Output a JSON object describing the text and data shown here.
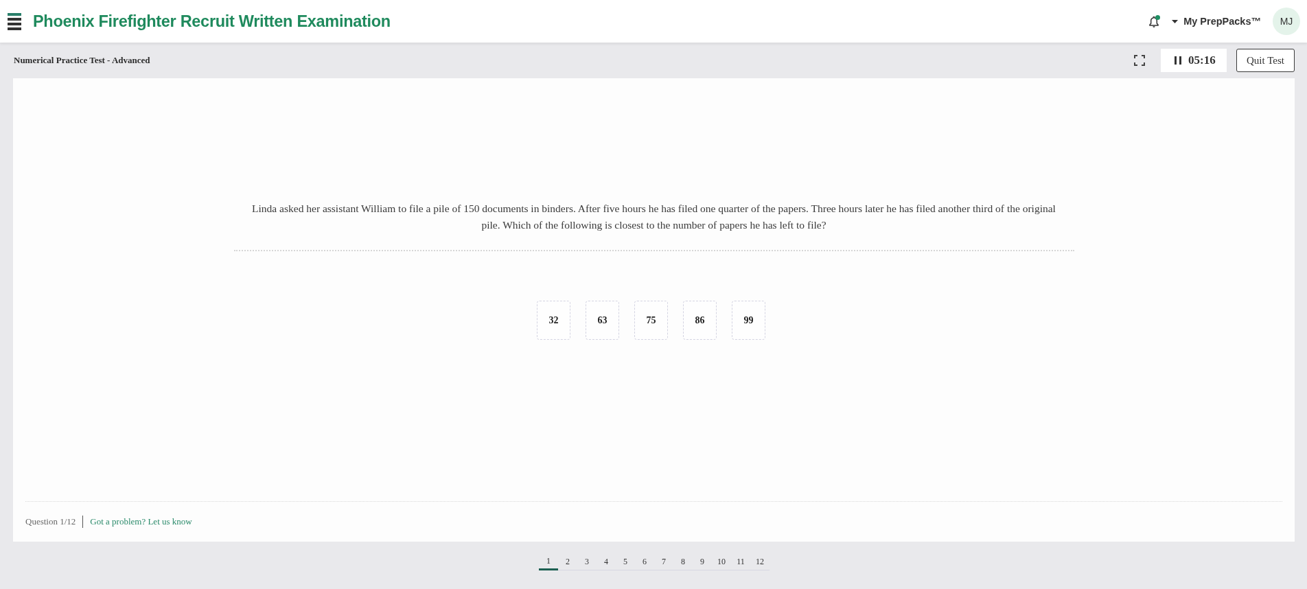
{
  "header": {
    "title": "Phoenix Firefighter Recruit Written Examination",
    "notifications": {
      "unread": true
    },
    "menu_label": "My PrepPacks™",
    "avatar": "MJ"
  },
  "test_bar": {
    "title": "Numerical Practice Test - Advanced",
    "timer": "05:16",
    "quit_button": "Quit Test"
  },
  "question": {
    "text": "Linda asked her assistant William to file a pile of 150 documents in binders. After five hours he has filed one quarter of the papers. Three hours later he has filed another third of the original pile. Which of the following is closest to the number of papers he has left to file?",
    "answers": [
      {
        "label": "32",
        "selected": false
      },
      {
        "label": "63",
        "selected": false
      },
      {
        "label": "75",
        "selected": false
      },
      {
        "label": "86",
        "selected": false
      },
      {
        "label": "99",
        "selected": false
      }
    ]
  },
  "footer": {
    "counter": "Question 1/12",
    "report_link": "Got a problem? Let us know"
  },
  "pagination": [
    {
      "label": "1",
      "selected": true
    },
    {
      "label": "2",
      "selected": false
    },
    {
      "label": "3",
      "selected": false
    },
    {
      "label": "4",
      "selected": false
    },
    {
      "label": "5",
      "selected": false
    },
    {
      "label": "6",
      "selected": false
    },
    {
      "label": "7",
      "selected": false
    },
    {
      "label": "8",
      "selected": false
    },
    {
      "label": "9",
      "selected": false
    },
    {
      "label": "10",
      "selected": false
    },
    {
      "label": "11",
      "selected": false
    },
    {
      "label": "12",
      "selected": false
    }
  ]
}
